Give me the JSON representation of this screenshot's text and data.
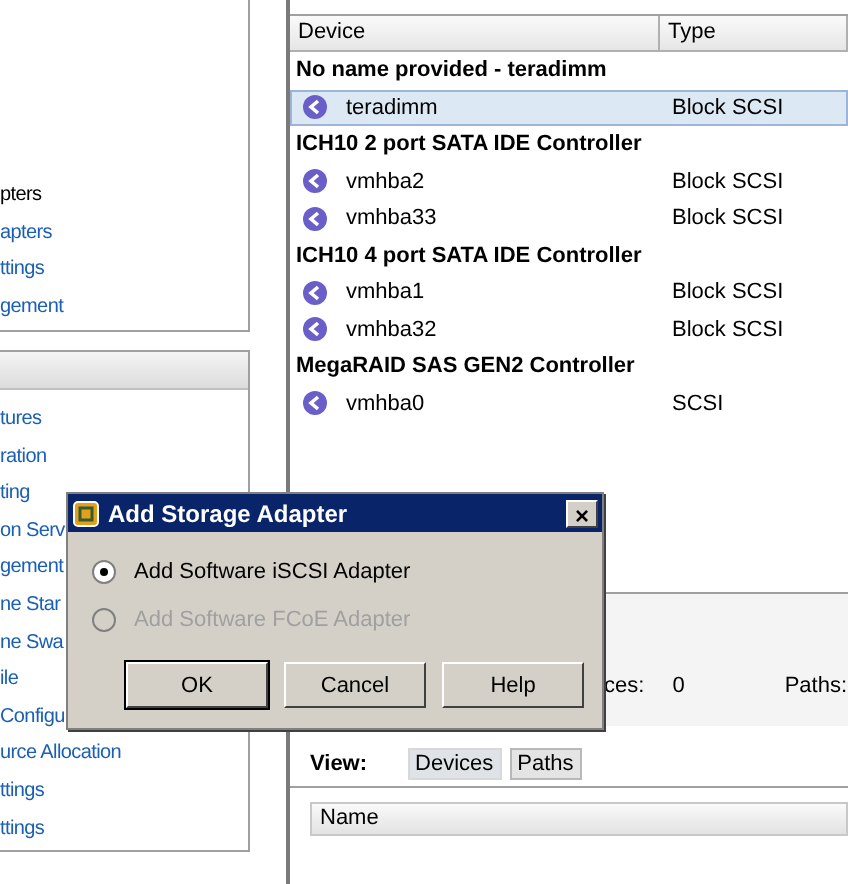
{
  "nav_panels": [
    {
      "items": [
        {
          "label": "pters",
          "selected": true
        },
        {
          "label": "apters",
          "selected": false
        },
        {
          "label": "ttings",
          "selected": false
        },
        {
          "label": "gement",
          "selected": false
        }
      ]
    },
    {
      "items": [
        {
          "label": "tures",
          "selected": false
        },
        {
          "label": "ration",
          "selected": false
        },
        {
          "label": "ting",
          "selected": false
        },
        {
          "label": "on Serv",
          "selected": false
        },
        {
          "label": "gement",
          "selected": false
        },
        {
          "label": "ne Star",
          "selected": false
        },
        {
          "label": "ne Swa",
          "selected": false
        },
        {
          "label": "ile",
          "selected": false
        },
        {
          "label": "Configu",
          "selected": false
        },
        {
          "label": "urce Allocation",
          "selected": false
        },
        {
          "label": "ttings",
          "selected": false
        },
        {
          "label": "ttings",
          "selected": false
        }
      ]
    }
  ],
  "device_table": {
    "columns": [
      "Device",
      "Type"
    ],
    "groups": [
      {
        "name": "No name provided - teradimm",
        "rows": [
          {
            "device": "teradimm",
            "type": "Block SCSI",
            "selected": true
          }
        ]
      },
      {
        "name": "ICH10 2 port SATA IDE Controller",
        "rows": [
          {
            "device": "vmhba2",
            "type": "Block SCSI",
            "selected": false
          },
          {
            "device": "vmhba33",
            "type": "Block SCSI",
            "selected": false
          }
        ]
      },
      {
        "name": "ICH10 4 port SATA IDE Controller",
        "rows": [
          {
            "device": "vmhba1",
            "type": "Block SCSI",
            "selected": false
          },
          {
            "device": "vmhba32",
            "type": "Block SCSI",
            "selected": false
          }
        ]
      },
      {
        "name": "MegaRAID SAS GEN2 Controller",
        "rows": [
          {
            "device": "vmhba0",
            "type": "SCSI",
            "selected": false
          }
        ]
      }
    ]
  },
  "details": {
    "devices_label": "ces:",
    "devices_value": "0",
    "paths_label": "Paths:",
    "view_label": "View:",
    "view_tabs": [
      {
        "label": "Devices",
        "selected": true
      },
      {
        "label": "Paths",
        "selected": false
      }
    ],
    "columns": [
      "Name"
    ]
  },
  "dialog": {
    "title": "Add Storage Adapter",
    "close": "×",
    "options": [
      {
        "label": "Add Software iSCSI Adapter",
        "selected": true,
        "disabled": false
      },
      {
        "label": "Add Software FCoE Adapter",
        "selected": false,
        "disabled": true
      }
    ],
    "buttons": [
      {
        "label": "OK",
        "default": true
      },
      {
        "label": "Cancel",
        "default": false
      },
      {
        "label": "Help",
        "default": false
      }
    ]
  }
}
